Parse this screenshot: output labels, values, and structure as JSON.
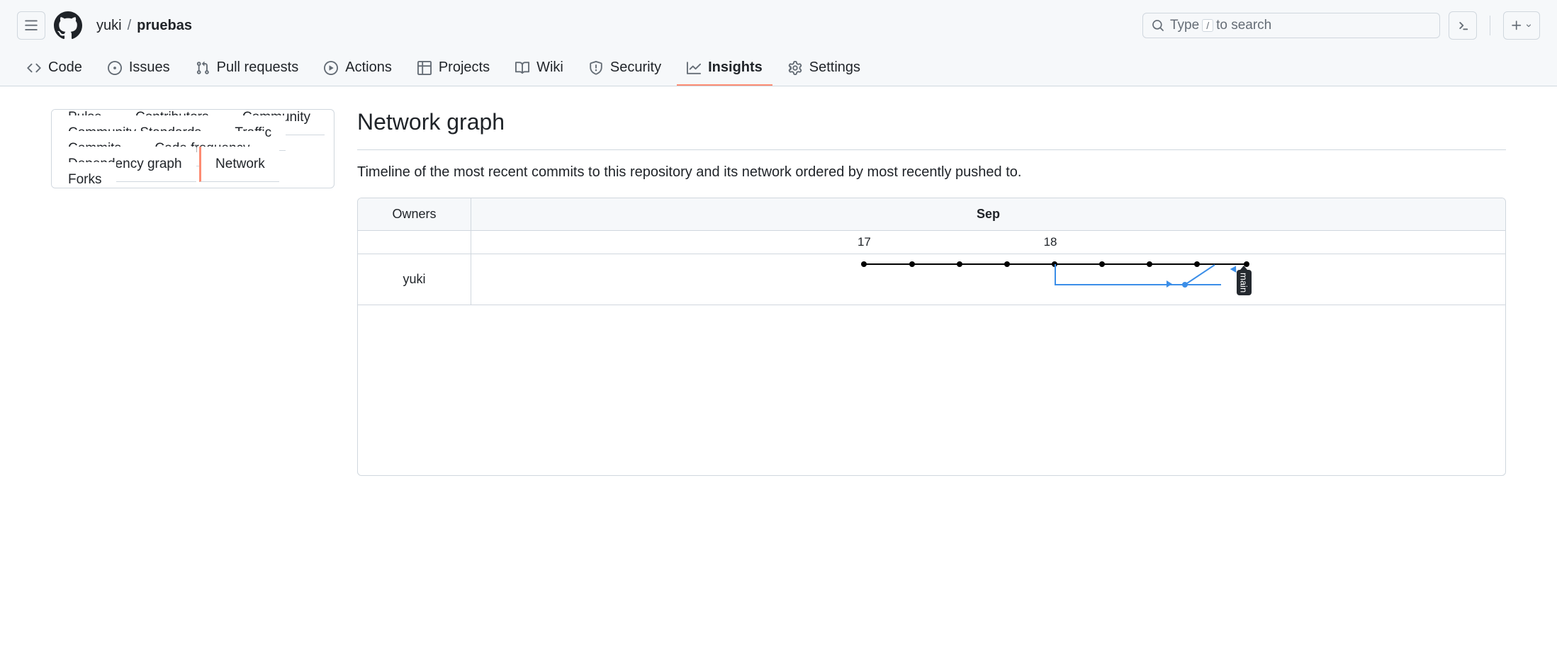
{
  "header": {
    "breadcrumb_owner": "yuki",
    "breadcrumb_sep": "/",
    "breadcrumb_repo": "pruebas",
    "search_prefix": "Type",
    "search_key": "/",
    "search_suffix": "to search"
  },
  "repo_tabs": [
    {
      "label": "Code"
    },
    {
      "label": "Issues"
    },
    {
      "label": "Pull requests"
    },
    {
      "label": "Actions"
    },
    {
      "label": "Projects"
    },
    {
      "label": "Wiki"
    },
    {
      "label": "Security"
    },
    {
      "label": "Insights"
    },
    {
      "label": "Settings"
    }
  ],
  "sidebar": {
    "items": [
      {
        "label": "Pulse"
      },
      {
        "label": "Contributors"
      },
      {
        "label": "Community"
      },
      {
        "label": "Community Standards"
      },
      {
        "label": "Traffic"
      },
      {
        "label": "Commits"
      },
      {
        "label": "Code frequency"
      },
      {
        "label": "Dependency graph"
      },
      {
        "label": "Network"
      },
      {
        "label": "Forks"
      }
    ]
  },
  "main": {
    "title": "Network graph",
    "subtitle": "Timeline of the most recent commits to this repository and its network ordered by most recently pushed to.",
    "owners_header": "Owners",
    "month": "Sep",
    "days": [
      "17",
      "18"
    ],
    "owner_row": "yuki",
    "branch_label": "main"
  },
  "chart_data": {
    "type": "line",
    "title": "Network graph",
    "xlabel": "Sep",
    "categories": [
      "17",
      "18"
    ],
    "series": [
      {
        "name": "main (black)",
        "commits": 9
      },
      {
        "name": "branch (blue)",
        "commits": 1,
        "merges_into": "main"
      }
    ],
    "owners": [
      "yuki"
    ]
  }
}
